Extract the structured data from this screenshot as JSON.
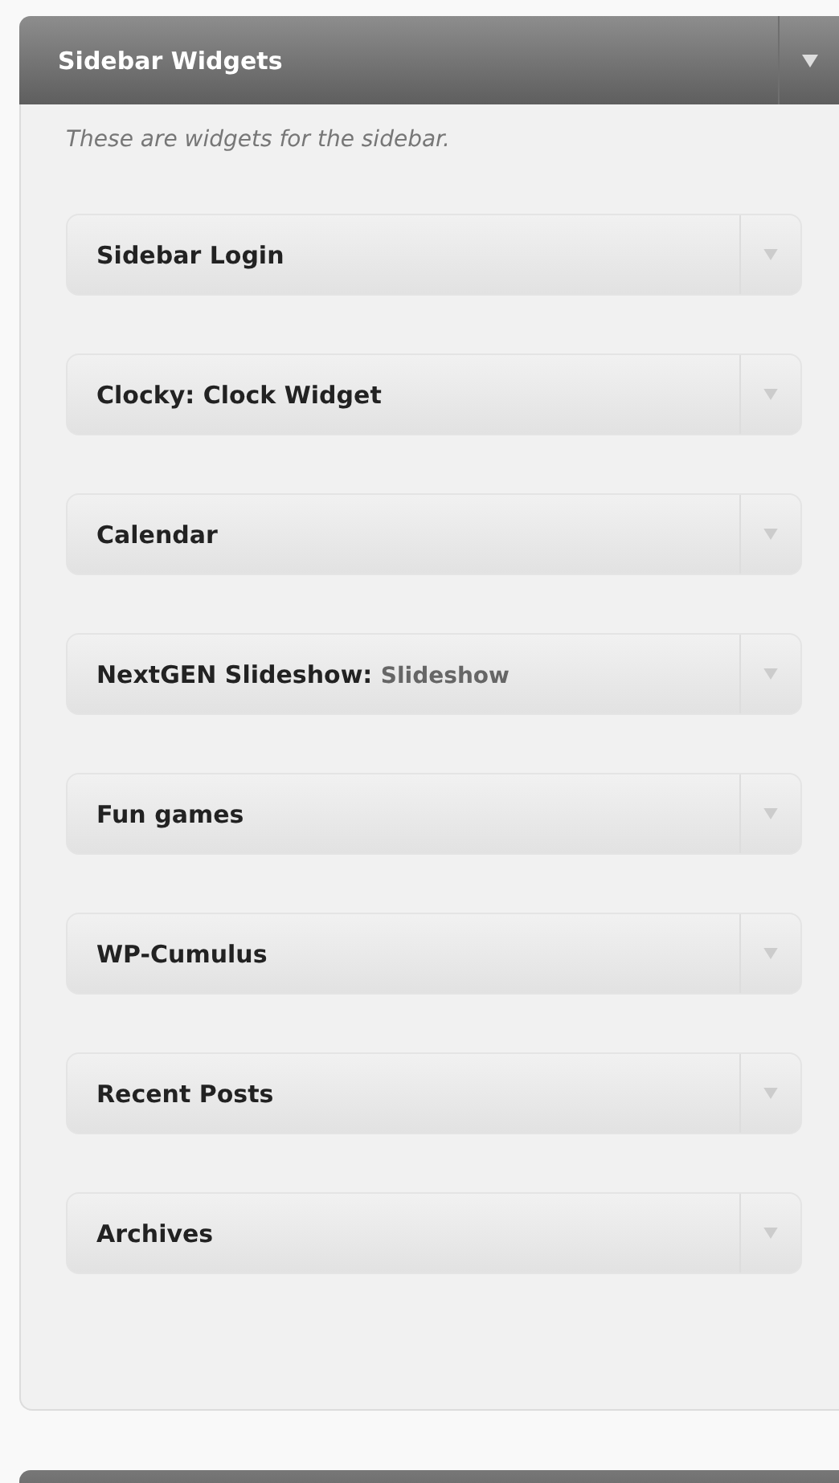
{
  "panel": {
    "title": "Sidebar Widgets",
    "description": "These are widgets for the sidebar.",
    "widgets": [
      {
        "title": "Sidebar Login"
      },
      {
        "title": "Clocky: Clock Widget"
      },
      {
        "title": "Calendar"
      },
      {
        "title": "NextGEN Slideshow:",
        "instance": "Slideshow"
      },
      {
        "title": "Fun games"
      },
      {
        "title": "WP-Cumulus"
      },
      {
        "title": "Recent Posts"
      },
      {
        "title": "Archives"
      }
    ]
  }
}
